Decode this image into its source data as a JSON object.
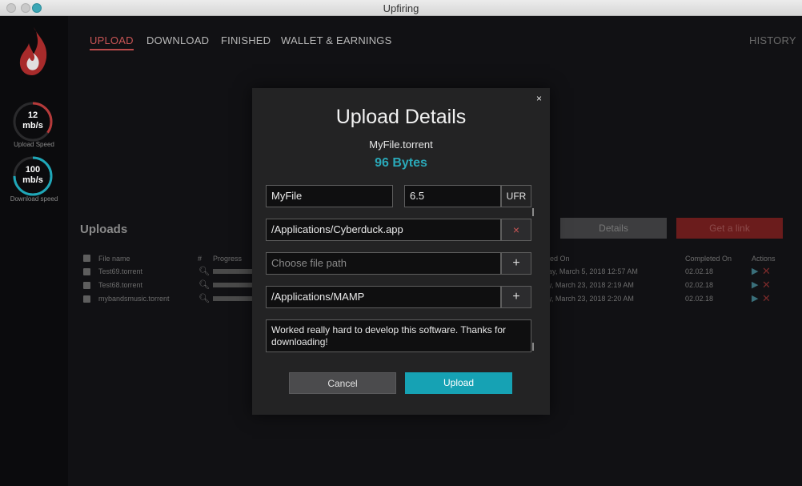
{
  "window": {
    "title": "Upfiring"
  },
  "sidebar": {
    "upload_speed": {
      "value": "12",
      "unit": "mb/s",
      "label": "Upload Speed",
      "arc_fraction": 0.35
    },
    "download_speed": {
      "value": "100",
      "unit": "mb/s",
      "label": "Download speed",
      "arc_fraction": 0.75
    }
  },
  "nav": {
    "tabs": [
      {
        "label": "UPLOAD",
        "active": true
      },
      {
        "label": "DOWNLOAD",
        "active": false
      },
      {
        "label": "FINISHED",
        "active": false
      },
      {
        "label": "WALLET & EARNINGS",
        "active": false
      }
    ],
    "history": "HISTORY"
  },
  "uploads": {
    "title": "Uploads",
    "details_button": "Details",
    "get_link_button": "Get a link",
    "columns": {
      "file_name": "File name",
      "hash": "#",
      "progress": "Progress",
      "uploaded_on": "ed On",
      "completed_on": "Completed On",
      "actions": "Actions"
    },
    "rows": [
      {
        "file_name": "Test69.torrent",
        "uploaded_on": "day, March 5, 2018 12:57 AM",
        "completed_on": "02.02.18"
      },
      {
        "file_name": "Test68.torrent",
        "uploaded_on": "ay, March 23, 2018 2:19 AM",
        "completed_on": "02.02.18"
      },
      {
        "file_name": "mybandsmusic.torrent",
        "uploaded_on": "ay, March 23, 2018 2:20 AM",
        "completed_on": "02.02.18"
      }
    ]
  },
  "modal": {
    "title": "Upload Details",
    "file_name": "MyFile.torrent",
    "file_size": "96 Bytes",
    "name_value": "MyFile",
    "price_value": "6.5",
    "currency": "UFR",
    "path1_value": "/Applications/Cyberduck.app",
    "path2_placeholder": "Choose file path",
    "path3_value": "/Applications/MAMP",
    "description": "Worked really hard to develop this software. Thanks for downloading!",
    "cancel_label": "Cancel",
    "upload_label": "Upload",
    "close_glyph": "×",
    "clear_glyph": "×",
    "add_glyph": "+"
  },
  "colors": {
    "accent": "#16a2b4",
    "brand_red": "#b84a4a",
    "size_text": "#2aa8b8"
  }
}
